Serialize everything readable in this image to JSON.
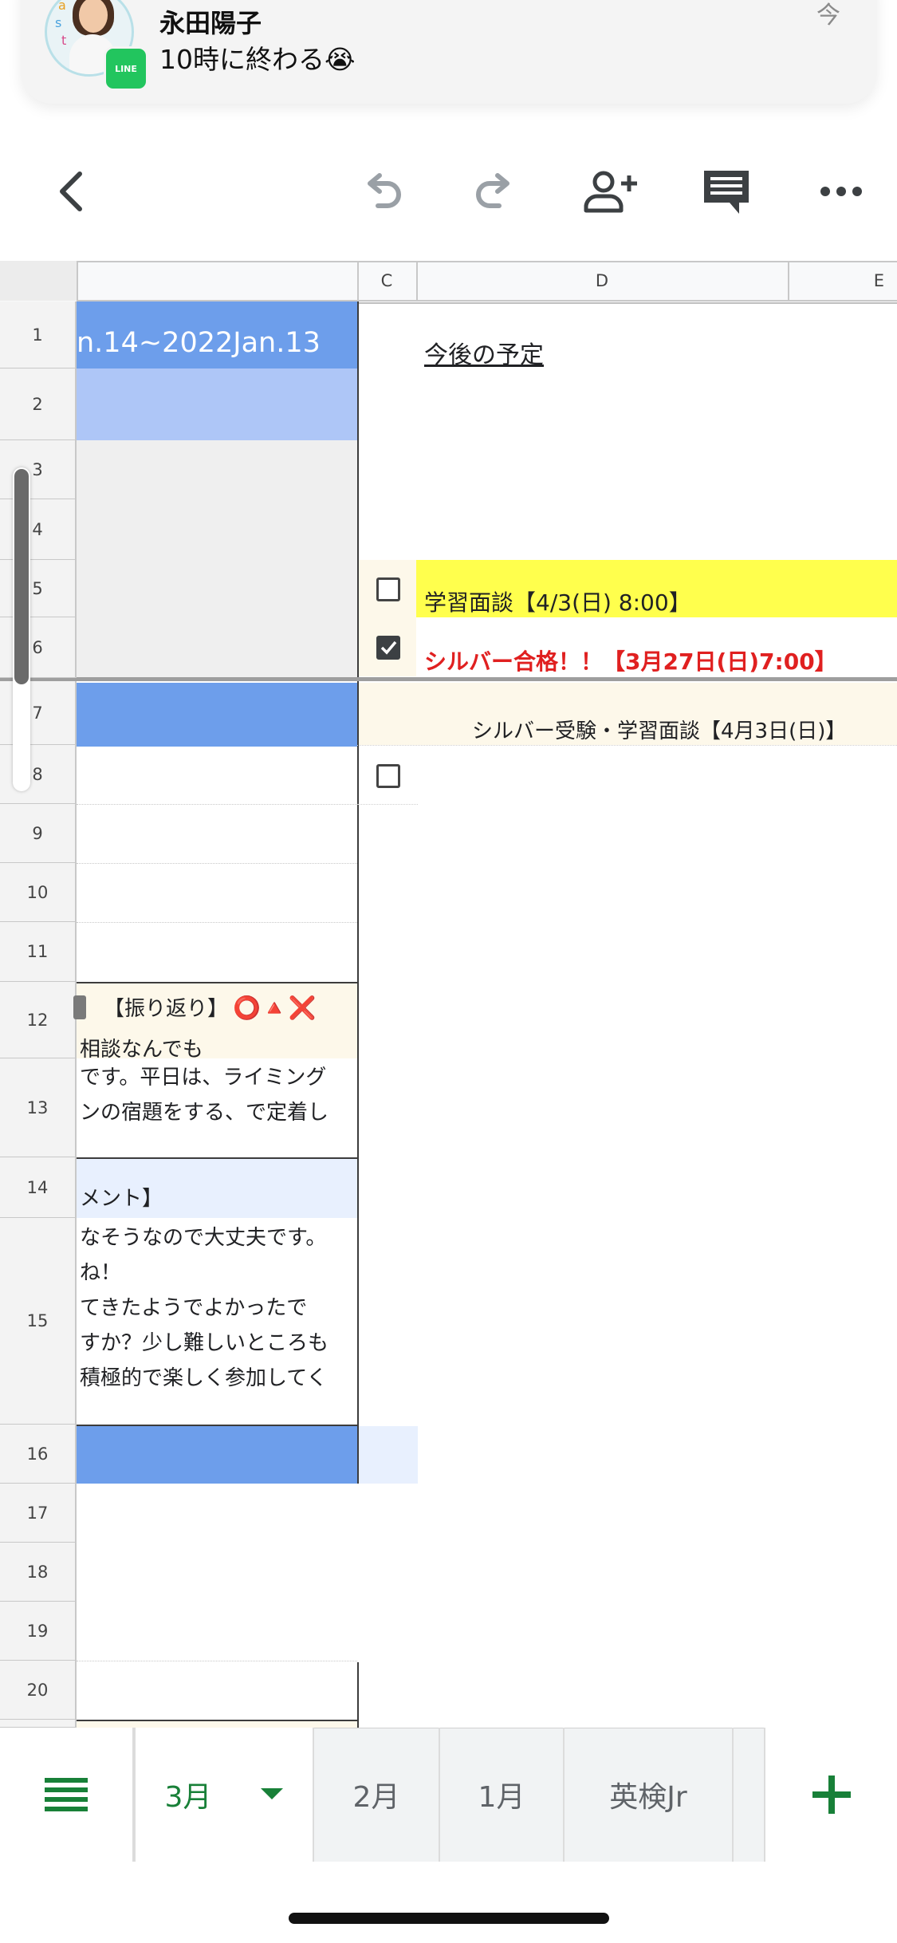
{
  "notification": {
    "sender": "永田陽子",
    "message": "10時に終わる😭",
    "time": "今",
    "app_badge": "LINE"
  },
  "toolbar": {
    "back_icon": "chevron-left-icon",
    "undo_icon": "undo-icon",
    "redo_icon": "redo-icon",
    "share_icon": "add-person-icon",
    "comment_icon": "comment-icon",
    "more_icon": "more-horizontal-icon"
  },
  "columns": [
    "C",
    "D",
    "E"
  ],
  "rows": [
    "1",
    "2",
    "3",
    "4",
    "5",
    "6",
    "7",
    "8",
    "9",
    "10",
    "11",
    "12",
    "13",
    "14",
    "15",
    "16",
    "17",
    "18",
    "19",
    "20"
  ],
  "cells": {
    "B1": "n.14~2022Jan.13",
    "B12": "【振り返り】",
    "B12_marks": "⭕🔺❌",
    "B12_line2": "相談なんでも",
    "B13_line1": "です。平日は、ライミング",
    "B13_line2": "ンの宿題をする、で定着し",
    "B14": "メント】",
    "B15_lines": [
      "なそうなので大丈夫です。",
      "ね！",
      "てきたようでよかったで",
      "すか？少し難しいところも",
      "積極的で楽しく参加してく"
    ],
    "D1": "今後の予定",
    "D5": "学習面談【4/3(日) 8:00】",
    "D6": "シルバー合格！！【3月27日(日)7:00】",
    "D7": "シルバー受験・学習面談【4月3日(日)】"
  },
  "checkboxes": {
    "C5": false,
    "C6": true,
    "C8": false
  },
  "colors": {
    "blue_header": "#6d9eeb",
    "light_blue": "#aec6f7",
    "pale_blue": "#e8f0fe",
    "cream": "#fdf8ea",
    "yellow": "#ffff4d",
    "red_text": "#e02020",
    "green": "#188038"
  },
  "tabs": {
    "menu_icon": "all-sheets-icon",
    "items": [
      {
        "label": "3月",
        "active": true
      },
      {
        "label": "2月",
        "active": false
      },
      {
        "label": "1月",
        "active": false
      },
      {
        "label": "英検Jr",
        "active": false
      }
    ],
    "dropdown_icon": "caret-down-icon",
    "add_icon": "plus-icon"
  }
}
